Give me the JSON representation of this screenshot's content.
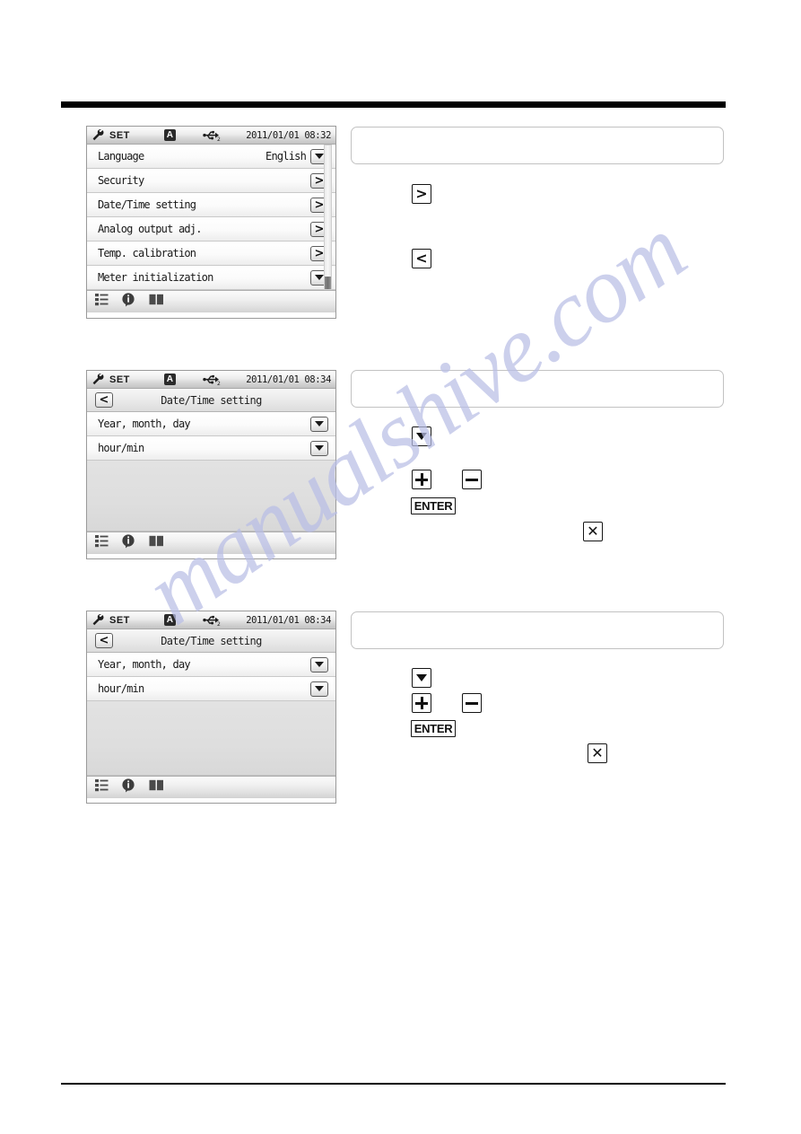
{
  "watermark": {
    "text": "manualshive.com"
  },
  "screens": [
    {
      "id": "settings-menu",
      "status": {
        "mode_label": "SET",
        "battery_badge": "A",
        "usb_label": "USB2",
        "datetime": "2011/01/01 08:32"
      },
      "subheader": null,
      "rows": [
        {
          "label": "Language",
          "value": "English",
          "control": "dropdown"
        },
        {
          "label": "Security",
          "value": "",
          "control": "next"
        },
        {
          "label": "Date/Time setting",
          "value": "",
          "control": "next"
        },
        {
          "label": "Analog output adj.",
          "value": "",
          "control": "next"
        },
        {
          "label": "Temp. calibration",
          "value": "",
          "control": "next"
        },
        {
          "label": "Meter initialization",
          "value": "",
          "control": "dropdown"
        }
      ],
      "fillers": 0,
      "scrollbar": true,
      "toolbar": [
        "list-icon",
        "info-icon",
        "book-icon"
      ]
    },
    {
      "id": "date-time-setting-1",
      "status": {
        "mode_label": "SET",
        "battery_badge": "A",
        "usb_label": "USB2",
        "datetime": "2011/01/01 08:34"
      },
      "subheader": {
        "back_label": "<",
        "title": "Date/Time setting"
      },
      "rows": [
        {
          "label": "Year, month, day",
          "value": "",
          "control": "dropdown"
        },
        {
          "label": "hour/min",
          "value": "",
          "control": "dropdown"
        }
      ],
      "fillers": 1,
      "scrollbar": false,
      "toolbar": [
        "list-icon",
        "info-icon",
        "book-icon"
      ]
    },
    {
      "id": "date-time-setting-2",
      "status": {
        "mode_label": "SET",
        "battery_badge": "A",
        "usb_label": "USB2",
        "datetime": "2011/01/01 08:34"
      },
      "subheader": {
        "back_label": "<",
        "title": "Date/Time setting"
      },
      "rows": [
        {
          "label": "Year, month, day",
          "value": "",
          "control": "dropdown"
        },
        {
          "label": "hour/min",
          "value": "",
          "control": "dropdown"
        }
      ],
      "fillers": 1,
      "scrollbar": false,
      "toolbar": [
        "list-icon",
        "info-icon",
        "book-icon"
      ]
    }
  ],
  "notes": [
    {
      "id": "note-1",
      "text": ""
    },
    {
      "id": "note-2",
      "text": ""
    },
    {
      "id": "note-3",
      "text": ""
    }
  ],
  "keys": {
    "right_arrow": ">",
    "left_arrow": "<",
    "down_arrow": "▼",
    "plus": "+",
    "minus": "−",
    "enter": "ENTER",
    "close": "✕"
  }
}
